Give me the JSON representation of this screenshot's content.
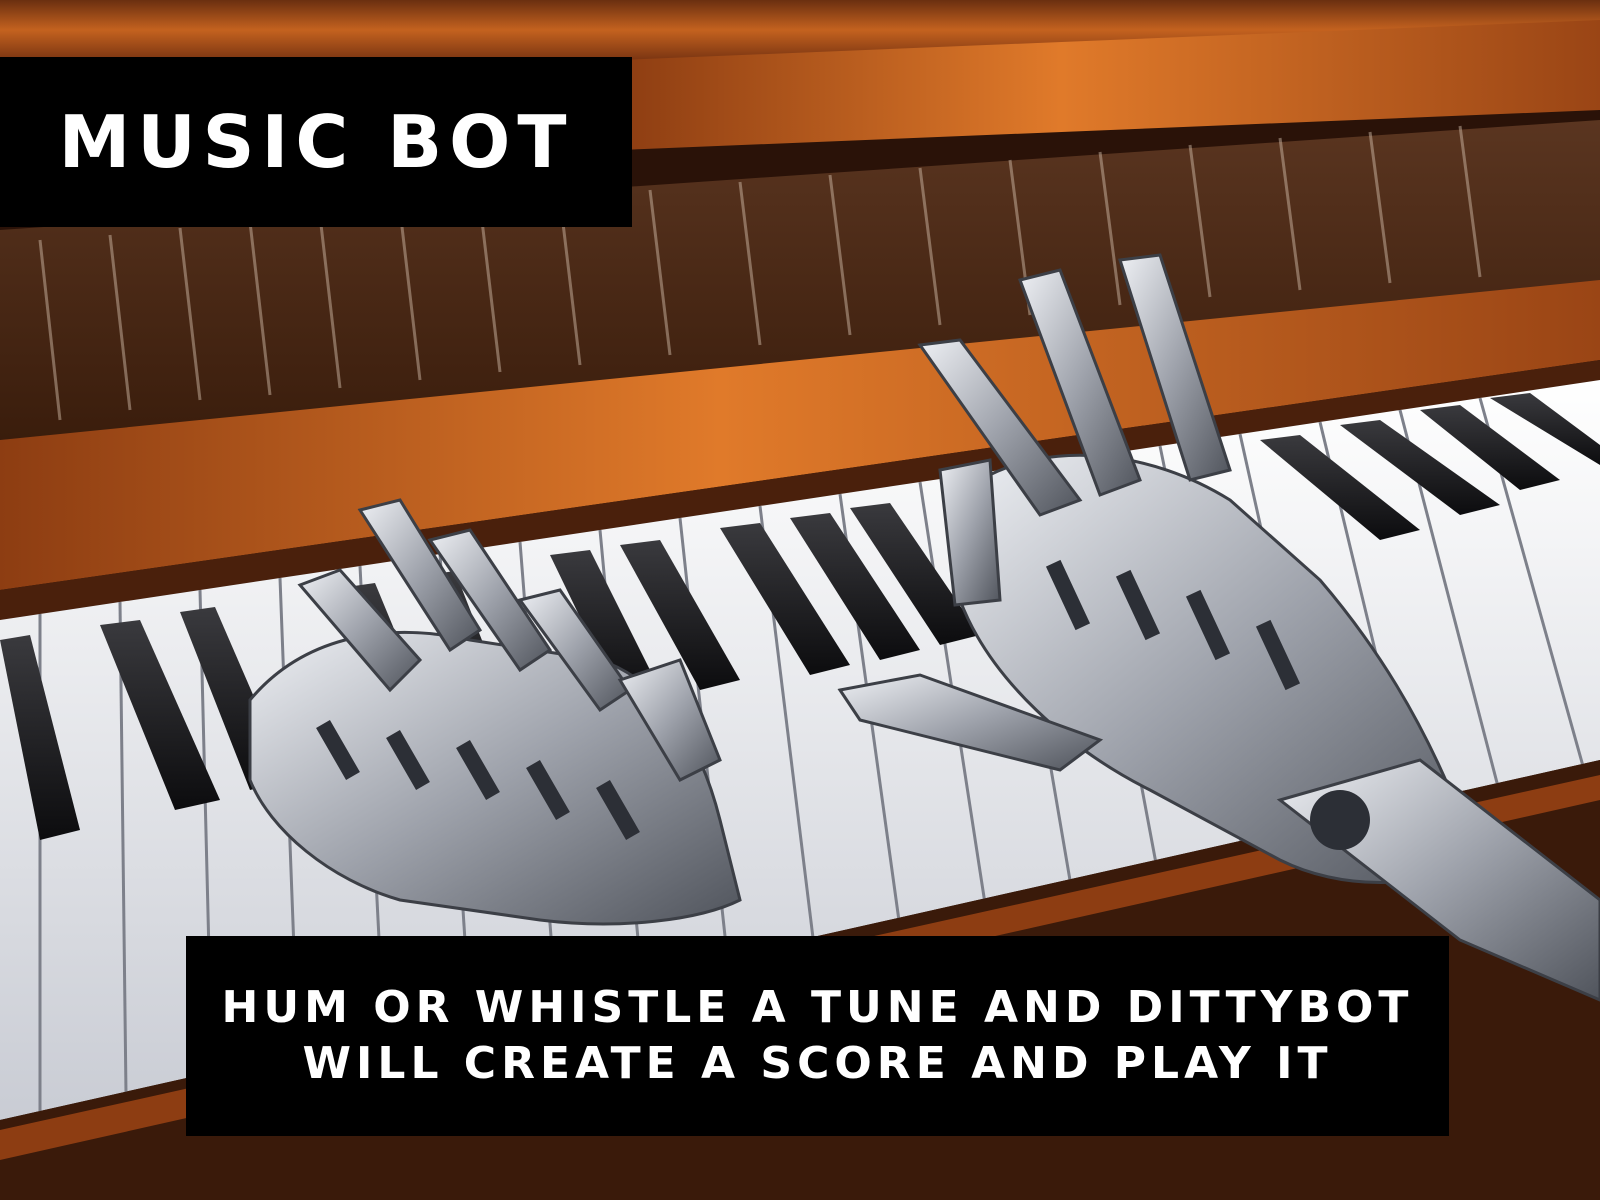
{
  "title": "MUSIC BOT",
  "caption": {
    "line1": "HUM OR WHISTLE A TUNE AND DITTYBOT",
    "line2": "WILL CREATE A SCORE AND PLAY IT"
  },
  "photo": {
    "subject": "robotic-hands-playing-piano",
    "icon": "robot-hands-icon"
  },
  "colors": {
    "label_background": "#000000",
    "label_text": "#ffffff",
    "wood": "#b8581e",
    "wood_dark": "#4a200c",
    "metal": "#b9bcc4"
  }
}
